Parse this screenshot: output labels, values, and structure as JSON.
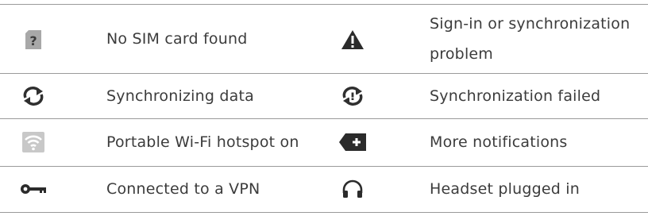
{
  "rows": [
    {
      "left": {
        "icon": "no-sim-card-icon",
        "label": "No SIM card found"
      },
      "right": {
        "icon": "warning-triangle-icon",
        "label_line1": "Sign-in or synchronization",
        "label_line2": "problem"
      }
    },
    {
      "left": {
        "icon": "sync-icon",
        "label": "Synchronizing data"
      },
      "right": {
        "icon": "sync-failed-icon",
        "label": "Synchronization failed"
      }
    },
    {
      "left": {
        "icon": "wifi-hotspot-icon",
        "label": "Portable Wi-Fi hotspot on"
      },
      "right": {
        "icon": "more-notifications-icon",
        "label": "More notifications"
      }
    },
    {
      "left": {
        "icon": "vpn-key-icon",
        "label": "Connected to a VPN"
      },
      "right": {
        "icon": "headset-icon",
        "label": "Headset plugged in"
      }
    }
  ]
}
